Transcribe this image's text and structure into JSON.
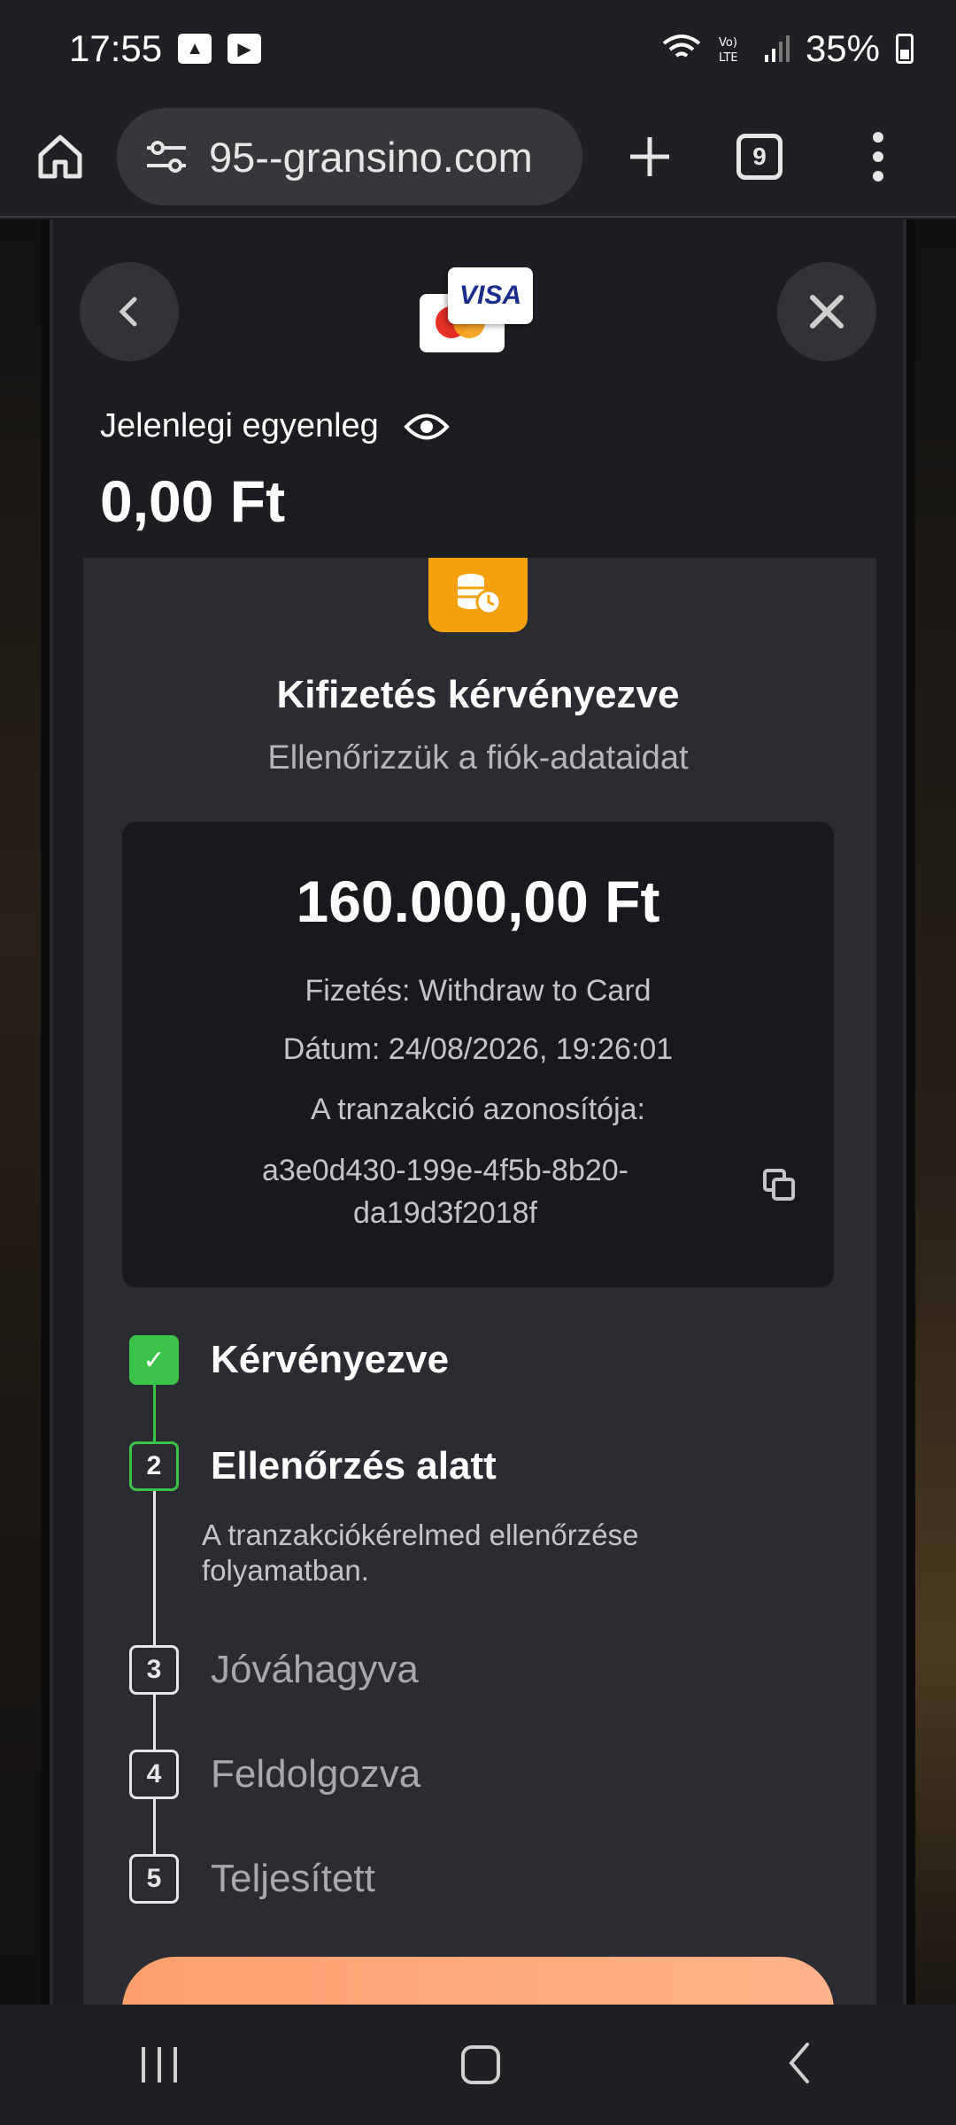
{
  "status_bar": {
    "time": "17:55",
    "battery": "35%"
  },
  "browser": {
    "url": "95--gransino.com",
    "tab_count": "9"
  },
  "header": {
    "balance_label": "Jelenlegi egyenleg",
    "balance_value": "0,00 Ft",
    "visa_text": "VISA"
  },
  "main": {
    "title": "Kifizetés kérvényezve",
    "subtitle": "Ellenőrizzük a fiók-adataidat"
  },
  "transaction": {
    "amount": "160.000,00 Ft",
    "payment": "Fizetés: Withdraw to Card",
    "date": "Dátum: 24/08/2026, 19:26:01",
    "id_label": "A tranzakció azonosítója:",
    "id_value": "a3e0d430-199e-4f5b-8b20-da19d3f2018f"
  },
  "steps": [
    {
      "number": "✓",
      "label": "Kérvényezve",
      "state": "done"
    },
    {
      "number": "2",
      "label": "Ellenőrzés alatt",
      "state": "active",
      "description": "A tranzakciókérelmed ellenőrzése folyamatban."
    },
    {
      "number": "3",
      "label": "Jóváhagyva",
      "state": "pending"
    },
    {
      "number": "4",
      "label": "Feldolgozva",
      "state": "pending"
    },
    {
      "number": "5",
      "label": "Teljesített",
      "state": "pending"
    }
  ],
  "colors": {
    "accent_green": "#3cc44a",
    "badge_orange": "#f5a00d",
    "cta_orange": "#ff9f6e"
  }
}
